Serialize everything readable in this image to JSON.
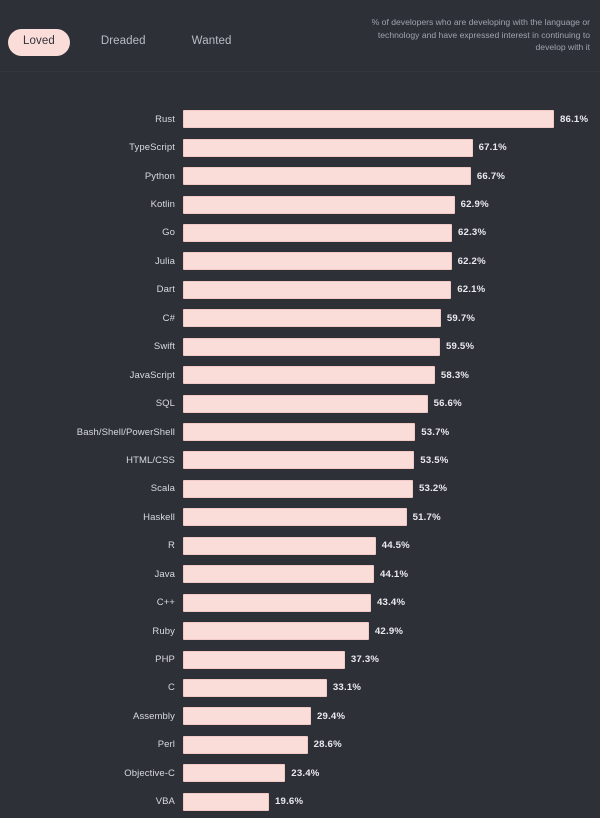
{
  "header": {
    "tabs": [
      {
        "id": "loved",
        "label": "Loved",
        "active": true
      },
      {
        "id": "dreaded",
        "label": "Dreaded",
        "active": false
      },
      {
        "id": "wanted",
        "label": "Wanted",
        "active": false
      }
    ],
    "note": "% of developers who are developing with the language or technology and have expressed interest in continuing to develop with it"
  },
  "colors": {
    "background": "#2e3038",
    "bar_fill": "#fadcd9",
    "bar_stroke": "#f3c9c5",
    "active_tab_bg": "#fadcd9",
    "active_tab_text": "#32343c",
    "label_text": "#d8dae0",
    "muted_text": "#9fa3ad",
    "value_text": "#e9eaee"
  },
  "chart_data": {
    "type": "bar",
    "orientation": "horizontal",
    "title": "",
    "subtitle": "% of developers who are developing with the language or technology and have expressed interest in continuing to develop with it",
    "xlabel": "",
    "ylabel": "",
    "xlim": [
      0,
      90
    ],
    "grid": false,
    "legend": null,
    "value_suffix": "%",
    "categories": [
      "Rust",
      "TypeScript",
      "Python",
      "Kotlin",
      "Go",
      "Julia",
      "Dart",
      "C#",
      "Swift",
      "JavaScript",
      "SQL",
      "Bash/Shell/PowerShell",
      "HTML/CSS",
      "Scala",
      "Haskell",
      "R",
      "Java",
      "C++",
      "Ruby",
      "PHP",
      "C",
      "Assembly",
      "Perl",
      "Objective-C",
      "VBA"
    ],
    "values": [
      86.1,
      67.1,
      66.7,
      62.9,
      62.3,
      62.2,
      62.1,
      59.7,
      59.5,
      58.3,
      56.6,
      53.7,
      53.5,
      53.2,
      51.7,
      44.5,
      44.1,
      43.4,
      42.9,
      37.3,
      33.1,
      29.4,
      28.6,
      23.4,
      19.6
    ],
    "labels": [
      "86.1%",
      "67.1%",
      "66.7%",
      "62.9%",
      "62.3%",
      "62.2%",
      "62.1%",
      "59.7%",
      "59.5%",
      "58.3%",
      "56.6%",
      "53.7%",
      "53.5%",
      "53.2%",
      "51.7%",
      "44.5%",
      "44.1%",
      "43.4%",
      "42.9%",
      "37.3%",
      "33.1%",
      "29.4%",
      "28.6%",
      "23.4%",
      "19.6%"
    ]
  }
}
